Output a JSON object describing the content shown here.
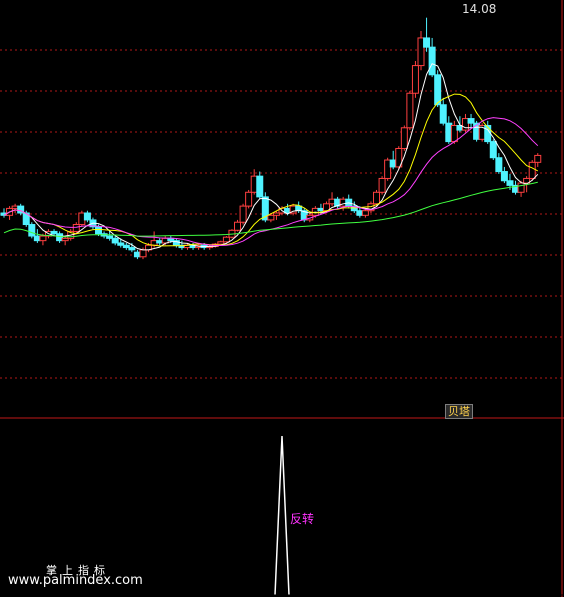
{
  "labels": {
    "high_price": "14.08",
    "badge": "贝塔",
    "signal": "反转",
    "watermark_cn": "掌上指标",
    "watermark_url": "www.palmindex.com"
  },
  "colors": {
    "background": "#000000",
    "grid": "#b01818",
    "separator": "#c01818",
    "up": "#ff4040",
    "down": "#4ff2ff",
    "ma5": "#ffffff",
    "ma10": "#ffff00",
    "ma20": "#ff40ff",
    "ma60": "#40ff40",
    "signal": "#ffffff"
  },
  "chart_data": [
    {
      "type": "candlestick",
      "title": "",
      "ylim": [
        0,
        14.5
      ],
      "grid": true,
      "x": [
        "0",
        "1",
        "2",
        "3",
        "4",
        "5",
        "6",
        "7",
        "8",
        "9",
        "10",
        "11",
        "12",
        "13",
        "14",
        "15",
        "16",
        "17",
        "18",
        "19",
        "20",
        "21",
        "22",
        "23",
        "24",
        "25",
        "26",
        "27",
        "28",
        "29",
        "30",
        "31",
        "32",
        "33",
        "34",
        "35",
        "36",
        "37",
        "38",
        "39",
        "40",
        "41",
        "42",
        "43",
        "44",
        "45",
        "46",
        "47",
        "48",
        "49",
        "50",
        "51",
        "52",
        "53",
        "54",
        "55",
        "56",
        "57",
        "58",
        "59",
        "60",
        "61",
        "62",
        "63",
        "64",
        "65",
        "66",
        "67",
        "68",
        "69",
        "70",
        "71",
        "72",
        "73",
        "74",
        "75",
        "76",
        "77",
        "78",
        "79",
        "80",
        "81",
        "82",
        "83",
        "84",
        "85",
        "86",
        "87",
        "88",
        "89",
        "90",
        "91",
        "92",
        "93",
        "94",
        "95",
        "96"
      ],
      "ohlc": [
        [
          5.6,
          5.8,
          5.4,
          5.5
        ],
        [
          5.5,
          5.9,
          5.3,
          5.8
        ],
        [
          5.8,
          6.0,
          5.6,
          5.9
        ],
        [
          5.9,
          6.0,
          5.5,
          5.6
        ],
        [
          5.6,
          5.7,
          5.0,
          5.1
        ],
        [
          5.1,
          5.2,
          4.5,
          4.6
        ],
        [
          4.6,
          4.9,
          4.3,
          4.4
        ],
        [
          4.4,
          4.7,
          4.2,
          4.6
        ],
        [
          4.6,
          4.9,
          4.5,
          4.8
        ],
        [
          4.8,
          4.9,
          4.6,
          4.7
        ],
        [
          4.7,
          4.8,
          4.3,
          4.4
        ],
        [
          4.4,
          4.6,
          4.2,
          4.5
        ],
        [
          4.5,
          4.9,
          4.4,
          4.8
        ],
        [
          4.8,
          5.2,
          4.7,
          5.1
        ],
        [
          5.1,
          5.7,
          5.0,
          5.6
        ],
        [
          5.6,
          5.7,
          5.2,
          5.3
        ],
        [
          5.3,
          5.4,
          4.9,
          5.0
        ],
        [
          5.0,
          5.1,
          4.6,
          4.7
        ],
        [
          4.7,
          4.8,
          4.5,
          4.6
        ],
        [
          4.6,
          4.8,
          4.4,
          4.5
        ],
        [
          4.5,
          4.6,
          4.2,
          4.3
        ],
        [
          4.3,
          4.5,
          4.1,
          4.2
        ],
        [
          4.2,
          4.3,
          4.0,
          4.1
        ],
        [
          4.1,
          4.3,
          3.9,
          4.0
        ],
        [
          3.9,
          4.0,
          3.6,
          3.7
        ],
        [
          3.7,
          4.1,
          3.6,
          4.0
        ],
        [
          4.0,
          4.3,
          3.9,
          4.2
        ],
        [
          4.2,
          4.8,
          4.1,
          4.4
        ],
        [
          4.4,
          4.5,
          4.2,
          4.3
        ],
        [
          4.3,
          4.6,
          4.2,
          4.5
        ],
        [
          4.5,
          4.6,
          4.3,
          4.4
        ],
        [
          4.4,
          4.5,
          4.1,
          4.2
        ],
        [
          4.2,
          4.4,
          4.0,
          4.1
        ],
        [
          4.1,
          4.3,
          4.0,
          4.2
        ],
        [
          4.2,
          4.3,
          4.0,
          4.1
        ],
        [
          4.1,
          4.3,
          4.0,
          4.2
        ],
        [
          4.2,
          4.3,
          4.0,
          4.1
        ],
        [
          4.1,
          4.2,
          4.0,
          4.15
        ],
        [
          4.15,
          4.3,
          4.1,
          4.25
        ],
        [
          4.25,
          4.4,
          4.2,
          4.35
        ],
        [
          4.35,
          4.6,
          4.3,
          4.55
        ],
        [
          4.55,
          4.9,
          4.5,
          4.85
        ],
        [
          4.85,
          5.3,
          4.8,
          5.2
        ],
        [
          5.2,
          6.0,
          5.1,
          5.9
        ],
        [
          5.9,
          6.6,
          5.8,
          6.5
        ],
        [
          6.5,
          7.5,
          6.4,
          7.2
        ],
        [
          7.2,
          7.4,
          6.2,
          6.3
        ],
        [
          6.3,
          6.5,
          5.2,
          5.3
        ],
        [
          5.3,
          5.6,
          5.2,
          5.5
        ],
        [
          5.5,
          5.7,
          5.3,
          5.6
        ],
        [
          5.6,
          5.9,
          5.5,
          5.8
        ],
        [
          5.8,
          6.0,
          5.5,
          5.6
        ],
        [
          5.6,
          6.0,
          5.5,
          5.9
        ],
        [
          5.9,
          6.1,
          5.6,
          5.7
        ],
        [
          5.7,
          5.8,
          5.2,
          5.3
        ],
        [
          5.3,
          5.6,
          5.2,
          5.5
        ],
        [
          5.5,
          5.9,
          5.4,
          5.8
        ],
        [
          5.8,
          6.0,
          5.6,
          5.7
        ],
        [
          5.7,
          6.1,
          5.6,
          6.0
        ],
        [
          6.0,
          6.5,
          5.9,
          6.2
        ],
        [
          6.2,
          6.3,
          5.8,
          5.9
        ],
        [
          5.9,
          6.3,
          5.7,
          6.2
        ],
        [
          6.2,
          6.4,
          5.8,
          5.9
        ],
        [
          5.9,
          6.1,
          5.6,
          5.7
        ],
        [
          5.7,
          5.9,
          5.4,
          5.5
        ],
        [
          5.5,
          5.8,
          5.4,
          5.7
        ],
        [
          5.7,
          6.1,
          5.6,
          6.0
        ],
        [
          6.0,
          6.6,
          5.9,
          6.5
        ],
        [
          6.5,
          7.2,
          6.4,
          7.1
        ],
        [
          7.1,
          8.0,
          7.0,
          7.9
        ],
        [
          7.9,
          8.3,
          7.5,
          7.6
        ],
        [
          7.6,
          8.5,
          7.5,
          8.4
        ],
        [
          8.4,
          9.4,
          8.3,
          9.3
        ],
        [
          9.3,
          10.9,
          9.2,
          10.8
        ],
        [
          10.8,
          12.2,
          10.6,
          12.0
        ],
        [
          12.0,
          13.5,
          11.8,
          13.2
        ],
        [
          13.2,
          14.08,
          12.6,
          12.8
        ],
        [
          12.8,
          13.2,
          11.5,
          11.6
        ],
        [
          11.6,
          11.8,
          10.2,
          10.3
        ],
        [
          10.3,
          10.6,
          9.4,
          9.5
        ],
        [
          9.5,
          9.8,
          8.6,
          8.7
        ],
        [
          8.7,
          9.6,
          8.6,
          9.4
        ],
        [
          9.4,
          9.8,
          9.1,
          9.2
        ],
        [
          9.2,
          9.9,
          9.1,
          9.7
        ],
        [
          9.7,
          9.9,
          9.3,
          9.5
        ],
        [
          9.5,
          9.6,
          8.7,
          8.8
        ],
        [
          8.8,
          9.5,
          8.7,
          9.4
        ],
        [
          9.4,
          9.6,
          8.6,
          8.7
        ],
        [
          8.7,
          8.8,
          7.9,
          8.0
        ],
        [
          8.0,
          8.2,
          7.3,
          7.4
        ],
        [
          7.4,
          7.6,
          6.9,
          7.0
        ],
        [
          7.0,
          7.3,
          6.6,
          6.8
        ],
        [
          6.8,
          7.0,
          6.4,
          6.5
        ],
        [
          6.5,
          7.0,
          6.3,
          6.9
        ],
        [
          6.9,
          7.2,
          6.5,
          7.1
        ],
        [
          7.1,
          7.9,
          7.0,
          7.8
        ],
        [
          7.8,
          8.2,
          7.6,
          8.1
        ]
      ],
      "moving_averages": [
        "MA5",
        "MA10",
        "MA20",
        "MA60"
      ]
    },
    {
      "type": "line",
      "title": "",
      "series": [
        {
          "values": [
            0,
            0,
            0,
            0,
            0,
            0,
            0,
            0,
            0,
            0,
            0,
            0,
            0,
            0,
            0,
            0,
            0,
            0,
            0,
            0,
            0,
            0,
            0,
            0,
            0,
            0,
            0,
            0,
            0,
            0,
            0,
            0,
            0,
            0,
            0,
            0,
            0,
            0,
            0,
            0,
            0,
            0,
            0,
            0,
            0,
            0,
            0,
            0,
            0,
            0,
            1,
            0,
            0,
            0,
            0,
            0,
            0,
            0,
            0,
            0,
            0,
            0,
            0,
            0,
            0,
            0,
            0,
            0,
            0,
            0,
            0,
            0,
            0,
            0,
            0,
            0,
            0,
            0,
            0,
            0,
            0,
            0,
            0,
            0,
            0,
            0,
            0,
            0,
            0,
            0,
            0,
            0,
            0,
            0,
            0,
            0,
            0
          ]
        }
      ],
      "ylim": [
        0,
        1
      ]
    }
  ]
}
